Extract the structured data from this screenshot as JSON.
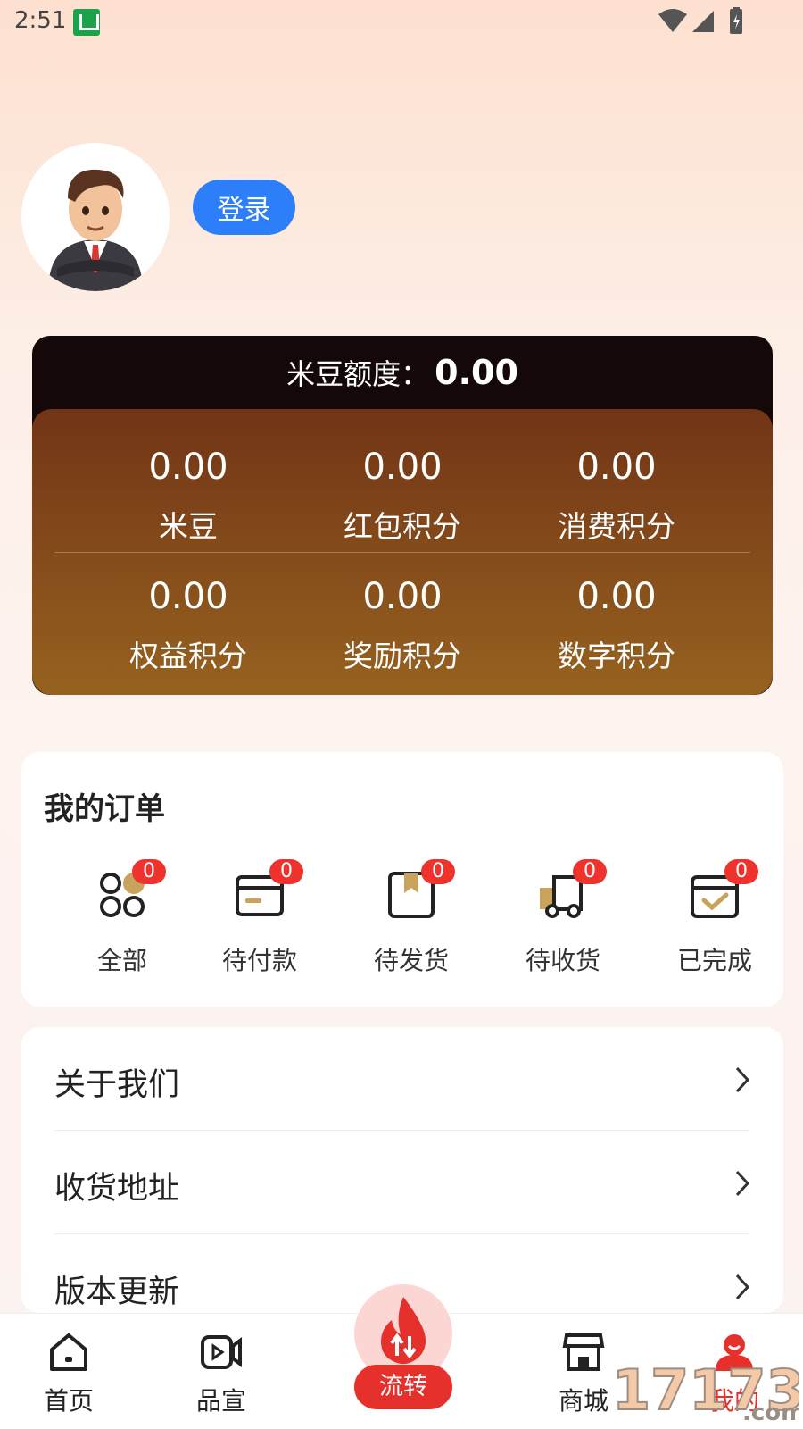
{
  "status_bar": {
    "time": "2:51"
  },
  "profile": {
    "login_label": "登录"
  },
  "points": {
    "quota_label": "米豆额度：",
    "quota_value": "0.00",
    "items": [
      {
        "value": "0.00",
        "label": "米豆"
      },
      {
        "value": "0.00",
        "label": "红包积分"
      },
      {
        "value": "0.00",
        "label": "消费积分"
      },
      {
        "value": "0.00",
        "label": "权益积分"
      },
      {
        "value": "0.00",
        "label": "奖励积分"
      },
      {
        "value": "0.00",
        "label": "数字积分"
      }
    ]
  },
  "orders": {
    "title": "我的订单",
    "items": [
      {
        "label": "全部",
        "count": "0",
        "icon": "all-orders-icon"
      },
      {
        "label": "待付款",
        "count": "0",
        "icon": "card-icon"
      },
      {
        "label": "待发货",
        "count": "0",
        "icon": "box-icon"
      },
      {
        "label": "待收货",
        "count": "0",
        "icon": "truck-icon"
      },
      {
        "label": "已完成",
        "count": "0",
        "icon": "check-icon"
      }
    ]
  },
  "menu": [
    {
      "label": "关于我们"
    },
    {
      "label": "收货地址"
    },
    {
      "label": "版本更新"
    }
  ],
  "tab_bar": {
    "items": [
      {
        "label": "首页",
        "icon": "home-icon"
      },
      {
        "label": "品宣",
        "icon": "video-icon"
      },
      {
        "label": "流转",
        "icon": "flame-icon"
      },
      {
        "label": "商城",
        "icon": "store-icon"
      },
      {
        "label": "我的",
        "icon": "user-icon"
      }
    ]
  },
  "watermark": {
    "text": "17173",
    "suffix": ".com"
  },
  "colors": {
    "accent_blue": "#2d7ff9",
    "badge_red": "#f0322d",
    "tab_active": "#e5302b",
    "points_brown": "#723416"
  }
}
